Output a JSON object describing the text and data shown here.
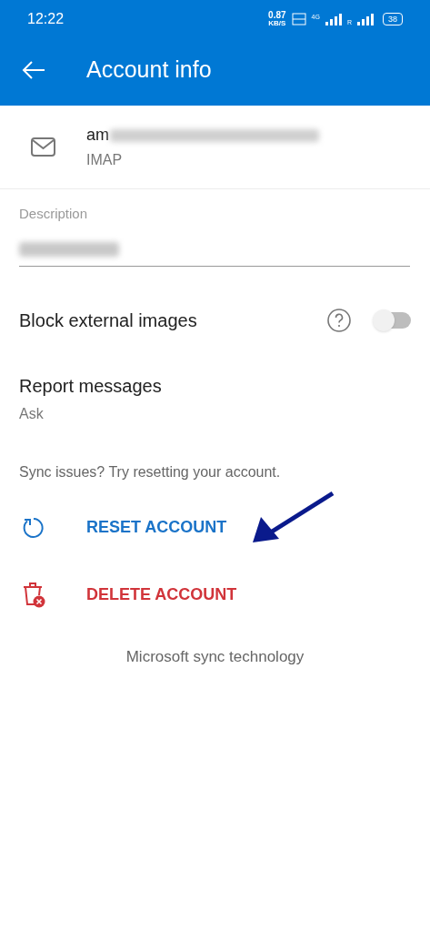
{
  "status_bar": {
    "time": "12:22",
    "net_speed": "0.87",
    "net_unit": "KB/S",
    "network": "4G",
    "roaming": "R",
    "battery": "38"
  },
  "app_bar": {
    "title": "Account info"
  },
  "account": {
    "email": "am",
    "type": "IMAP"
  },
  "description_field": {
    "label": "Description"
  },
  "settings": [
    {
      "kind": "toggle",
      "label": "Block external images",
      "checked": false
    },
    {
      "kind": "value",
      "label": "Report messages",
      "value": "Ask"
    }
  ],
  "sync_hint": "Sync issues? Try resetting your account.",
  "actions": [
    {
      "kind": "reset",
      "label": "RESET ACCOUNT",
      "color": "#1a73c8"
    },
    {
      "kind": "delete",
      "label": "DELETE ACCOUNT",
      "color": "#d1343a"
    }
  ],
  "footer": "Microsoft sync technology"
}
